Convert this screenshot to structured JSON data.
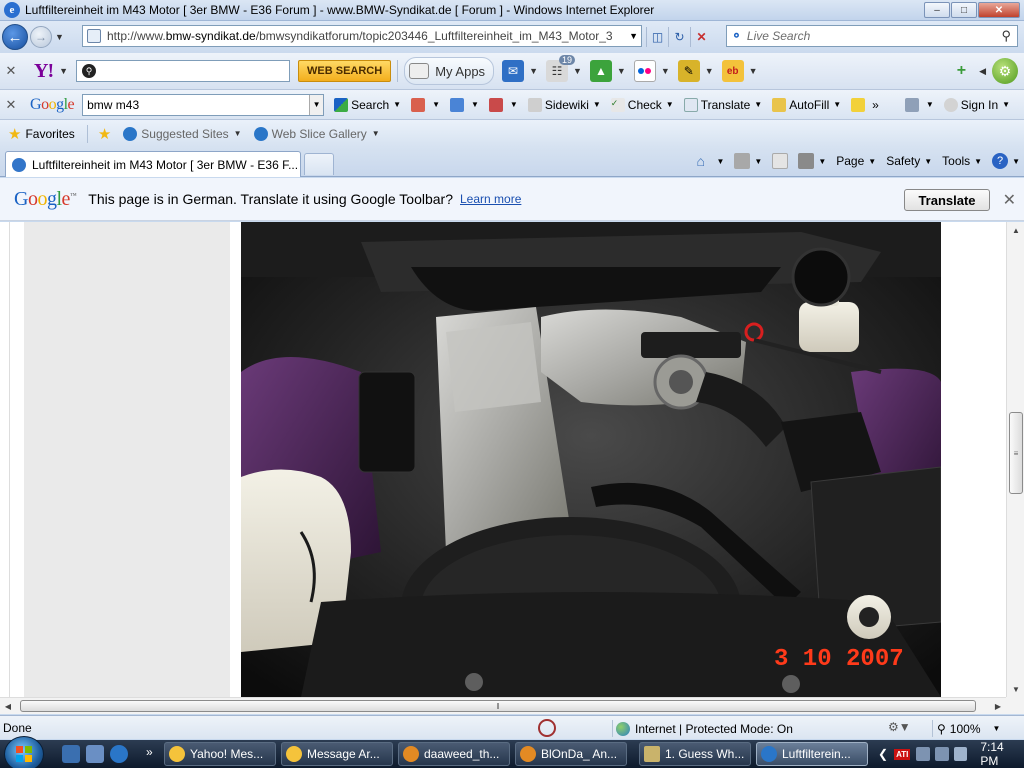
{
  "window": {
    "title": "Luftfiltereinheit im M43 Motor [ 3er BMW - E36 Forum ] - www.BMW-Syndikat.de [ Forum ] - Windows Internet Explorer",
    "ie_glyph": "e"
  },
  "address": {
    "url_prefix": "http://www.",
    "url_domain": "bmw-syndikat.de",
    "url_rest": "/bmwsyndikatforum/topic203446_Luftfiltereinheit_im_M43_Motor_3",
    "search_placeholder": "Live Search"
  },
  "yahoo_toolbar": {
    "logo": "Y!",
    "search_value": "",
    "search_button": "WEB SEARCH",
    "my_apps": "My Apps",
    "news_badge": "19"
  },
  "google_toolbar": {
    "logo": "Google",
    "query": "bmw m43",
    "buttons": [
      "Search",
      "Sidewiki",
      "Check",
      "Translate",
      "AutoFill",
      "Sign In"
    ],
    "more": "»"
  },
  "favorites_bar": {
    "favorites": "Favorites",
    "links": [
      "Suggested Sites",
      "Web Slice Gallery"
    ]
  },
  "tabs": {
    "active": "Luftfiltereinheit im M43 Motor [ 3er BMW - E36 F..."
  },
  "command_bar": {
    "items": [
      "Page",
      "Safety",
      "Tools"
    ]
  },
  "translate_bar": {
    "logo": "Google",
    "message": "This page is in German.  Translate it using Google Toolbar?",
    "learn_more": "Learn more",
    "button": "Translate"
  },
  "content": {
    "photo_date": "3 10 2007"
  },
  "status": {
    "text": "Done",
    "zone": "Internet | Protected Mode: On",
    "zoom": "100%"
  },
  "taskbar": {
    "tasks": [
      {
        "label": "Yahoo! Mes...",
        "active": false
      },
      {
        "label": "Message Ar...",
        "active": false
      },
      {
        "label": "daaweed_th...",
        "active": false
      },
      {
        "label": "BlOnDa_ An...",
        "active": false
      },
      {
        "label": "1. Guess Wh...",
        "active": false
      },
      {
        "label": "Luftfilterein...",
        "active": true
      }
    ],
    "clock": "7:14 PM"
  },
  "colors": {
    "yahoo_purple": "#7b0099",
    "google_blue": "#1a62c4",
    "link_blue": "#1a4fb0"
  }
}
